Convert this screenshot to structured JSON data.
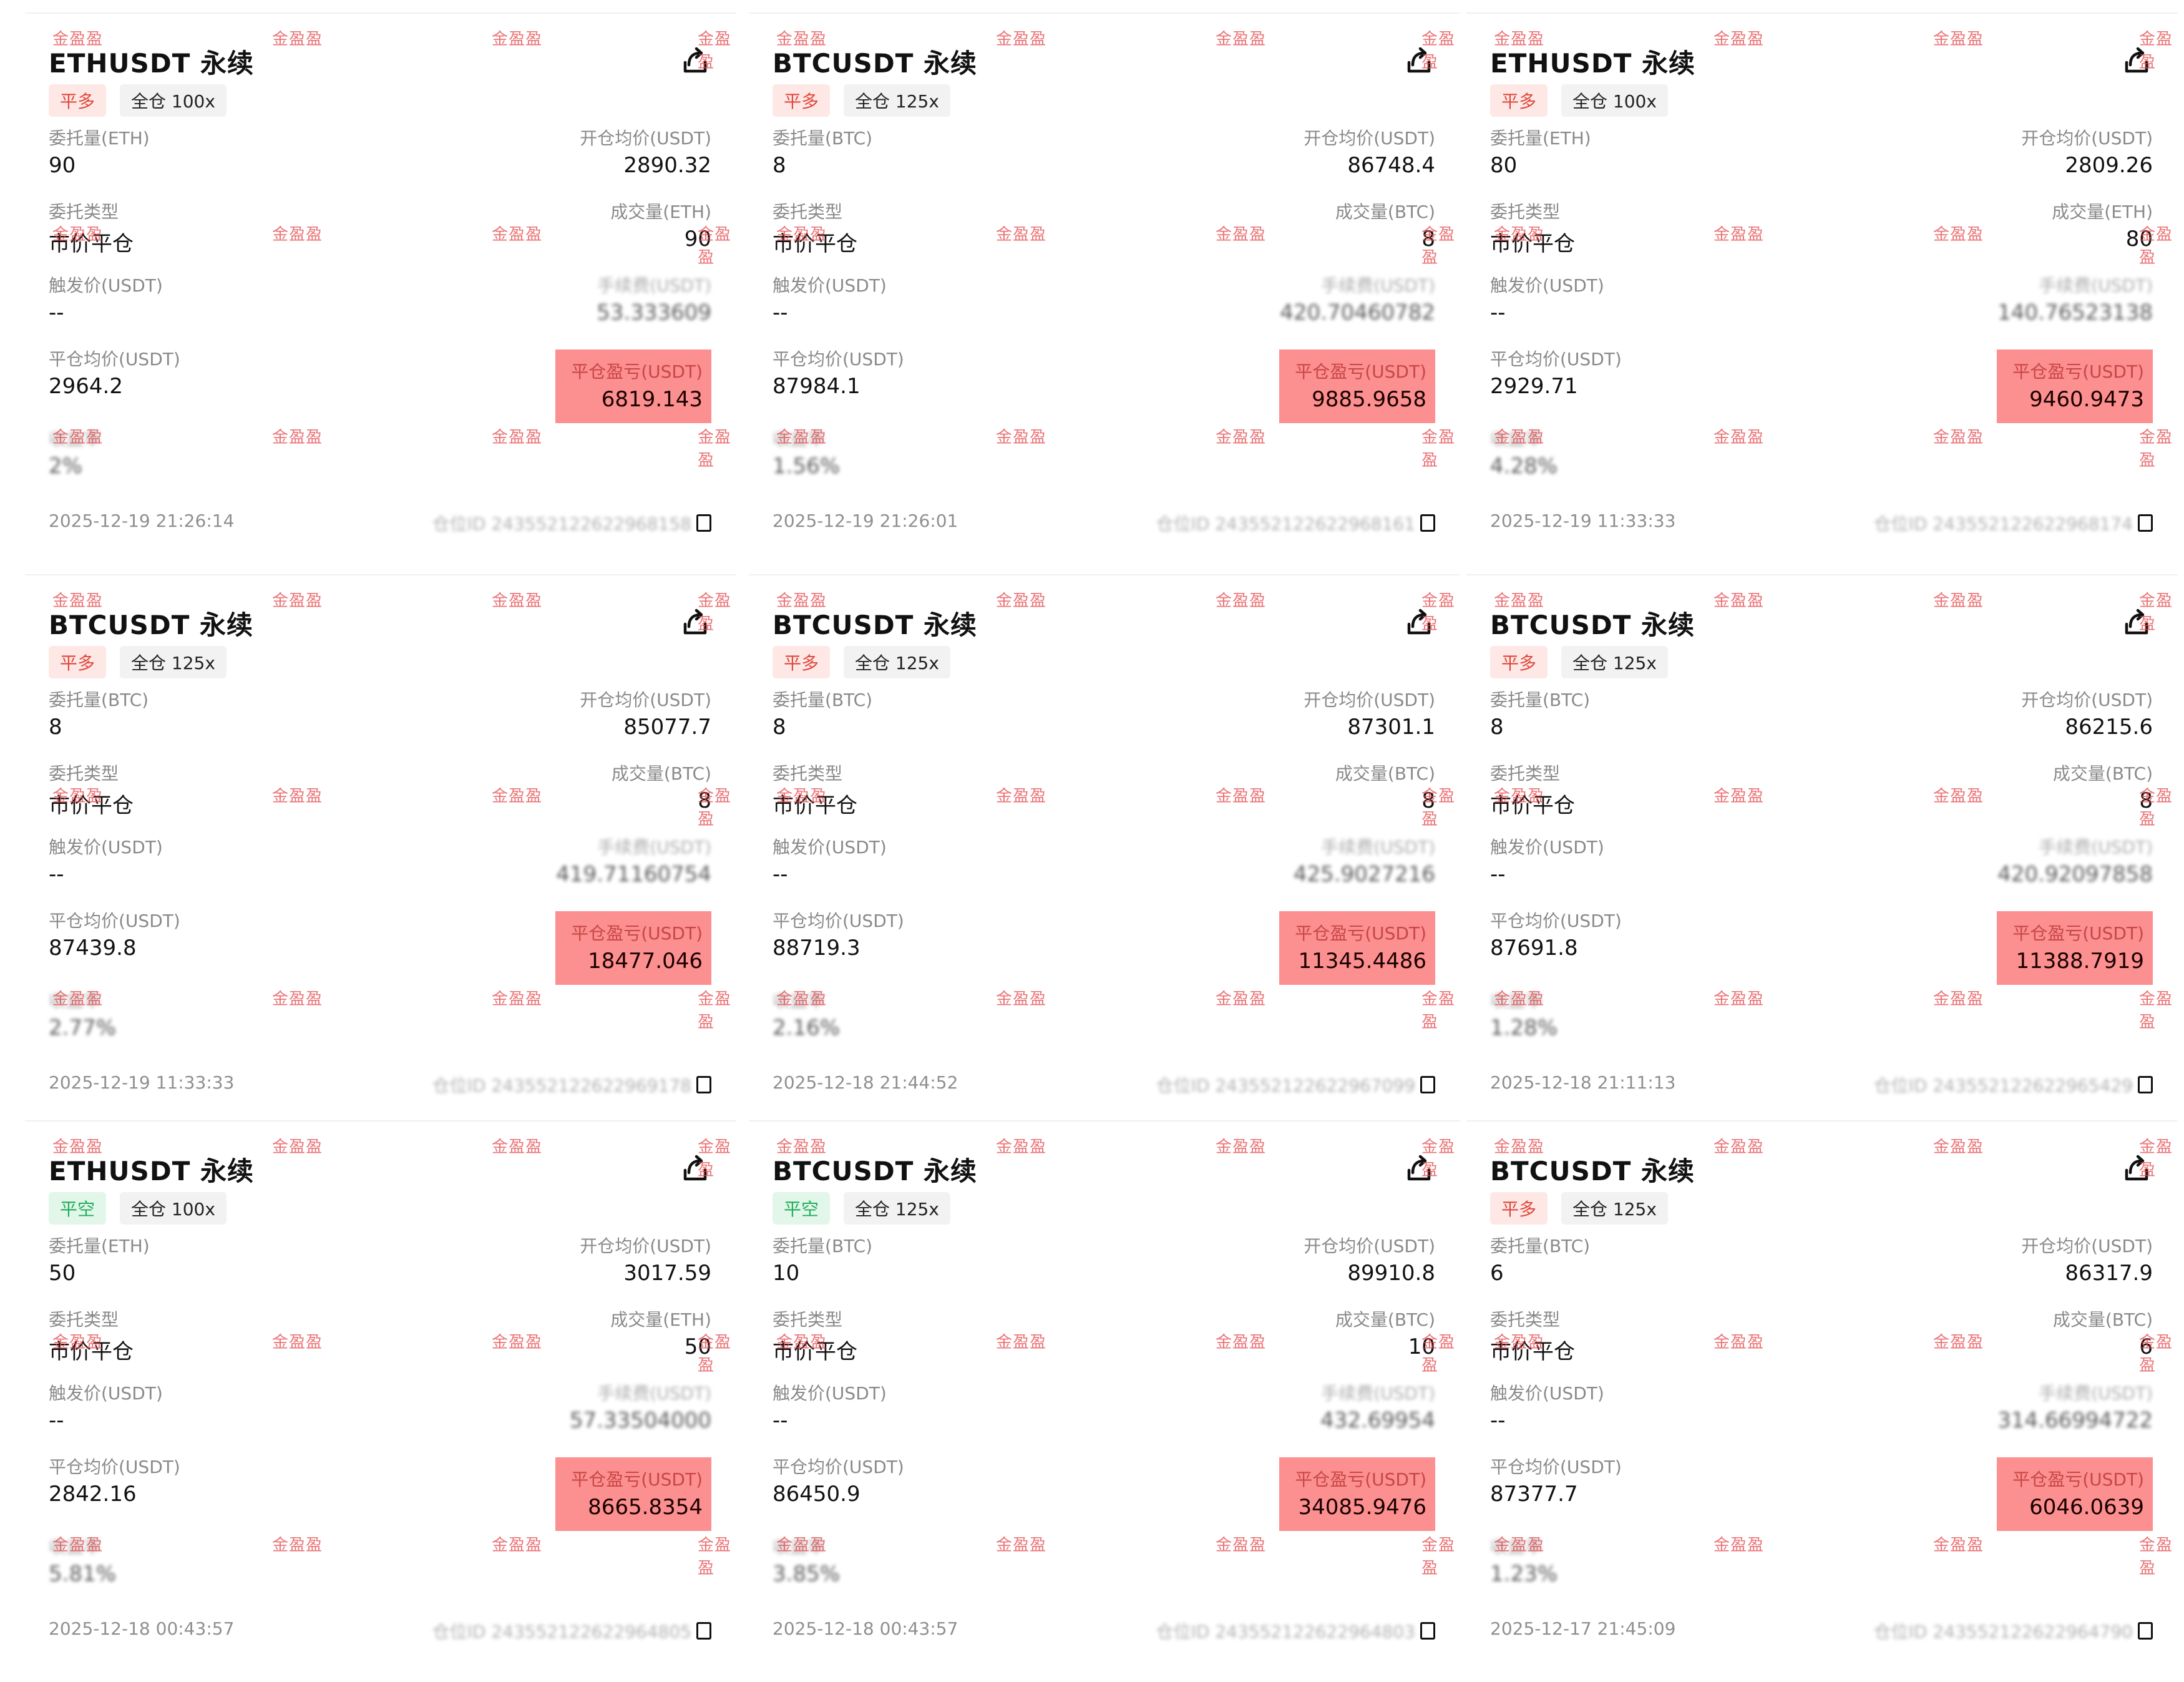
{
  "watermark": "金盈盈",
  "labels": {
    "order_qty": "委托量",
    "open_avg": "开仓均价(USDT)",
    "order_type": "委托类型",
    "filled": "成交量",
    "trigger": "触发价(USDT)",
    "fee": "手续费(USDT)",
    "close_avg": "平仓均价(USDT)",
    "pnl": "平仓盈亏(USDT)",
    "yield": "收益率"
  },
  "cards": [
    {
      "title": "ETHUSDT 永续",
      "side": "平多",
      "side_type": "long",
      "margin": "全仓 100x",
      "unit": "(ETH)",
      "qty": "90",
      "open_avg": "2890.32",
      "order_type": "市价平仓",
      "filled": "90",
      "trigger": "--",
      "fee": "53.333609",
      "close_avg": "2964.2",
      "pnl": "6819.143",
      "yield": "2%",
      "date": "2025-12-19 21:26:14",
      "pos_id": "仓位ID 243552122622968158"
    },
    {
      "title": "BTCUSDT 永续",
      "side": "平多",
      "side_type": "long",
      "margin": "全仓 125x",
      "unit": "(BTC)",
      "qty": "8",
      "open_avg": "86748.4",
      "order_type": "市价平仓",
      "filled": "8",
      "trigger": "--",
      "fee": "420.70460782",
      "close_avg": "87984.1",
      "pnl": "9885.9658",
      "yield": "1.56%",
      "date": "2025-12-19 21:26:01",
      "pos_id": "仓位ID 243552122622968161"
    },
    {
      "title": "ETHUSDT 永续",
      "side": "平多",
      "side_type": "long",
      "margin": "全仓 100x",
      "unit": "(ETH)",
      "qty": "80",
      "open_avg": "2809.26",
      "order_type": "市价平仓",
      "filled": "80",
      "trigger": "--",
      "fee": "140.76523138",
      "close_avg": "2929.71",
      "pnl": "9460.9473",
      "yield": "4.28%",
      "date": "2025-12-19 11:33:33",
      "pos_id": "仓位ID 243552122622968174"
    },
    {
      "title": "BTCUSDT 永续",
      "side": "平多",
      "side_type": "long",
      "margin": "全仓 125x",
      "unit": "(BTC)",
      "qty": "8",
      "open_avg": "85077.7",
      "order_type": "市价平仓",
      "filled": "8",
      "trigger": "--",
      "fee": "419.71160754",
      "close_avg": "87439.8",
      "pnl": "18477.046",
      "yield": "2.77%",
      "date": "2025-12-19 11:33:33",
      "pos_id": "仓位ID 243552122622969178"
    },
    {
      "title": "BTCUSDT 永续",
      "side": "平多",
      "side_type": "long",
      "margin": "全仓 125x",
      "unit": "(BTC)",
      "qty": "8",
      "open_avg": "87301.1",
      "order_type": "市价平仓",
      "filled": "8",
      "trigger": "--",
      "fee": "425.9027216",
      "close_avg": "88719.3",
      "pnl": "11345.4486",
      "yield": "2.16%",
      "date": "2025-12-18 21:44:52",
      "pos_id": "仓位ID 243552122622967099"
    },
    {
      "title": "BTCUSDT 永续",
      "side": "平多",
      "side_type": "long",
      "margin": "全仓 125x",
      "unit": "(BTC)",
      "qty": "8",
      "open_avg": "86215.6",
      "order_type": "市价平仓",
      "filled": "8",
      "trigger": "--",
      "fee": "420.92097858",
      "close_avg": "87691.8",
      "pnl": "11388.7919",
      "yield": "1.28%",
      "date": "2025-12-18 21:11:13",
      "pos_id": "仓位ID 243552122622965429"
    },
    {
      "title": "ETHUSDT 永续",
      "side": "平空",
      "side_type": "short",
      "margin": "全仓 100x",
      "unit": "(ETH)",
      "qty": "50",
      "open_avg": "3017.59",
      "order_type": "市价平仓",
      "filled": "50",
      "trigger": "--",
      "fee": "57.33504000",
      "close_avg": "2842.16",
      "pnl": "8665.8354",
      "yield": "5.81%",
      "date": "2025-12-18 00:43:57",
      "pos_id": "仓位ID 243552122622964805"
    },
    {
      "title": "BTCUSDT 永续",
      "side": "平空",
      "side_type": "short",
      "margin": "全仓 125x",
      "unit": "(BTC)",
      "qty": "10",
      "open_avg": "89910.8",
      "order_type": "市价平仓",
      "filled": "10",
      "trigger": "--",
      "fee": "432.69954",
      "close_avg": "86450.9",
      "pnl": "34085.9476",
      "yield": "3.85%",
      "date": "2025-12-18 00:43:57",
      "pos_id": "仓位ID 243552122622964803"
    },
    {
      "title": "BTCUSDT 永续",
      "side": "平多",
      "side_type": "long",
      "margin": "全仓 125x",
      "unit": "(BTC)",
      "qty": "6",
      "open_avg": "86317.9",
      "order_type": "市价平仓",
      "filled": "6",
      "trigger": "--",
      "fee": "314.66994722",
      "close_avg": "87377.7",
      "pnl": "6046.0639",
      "yield": "1.23%",
      "date": "2025-12-17 21:45:09",
      "pos_id": "仓位ID 243552122622964790"
    }
  ]
}
